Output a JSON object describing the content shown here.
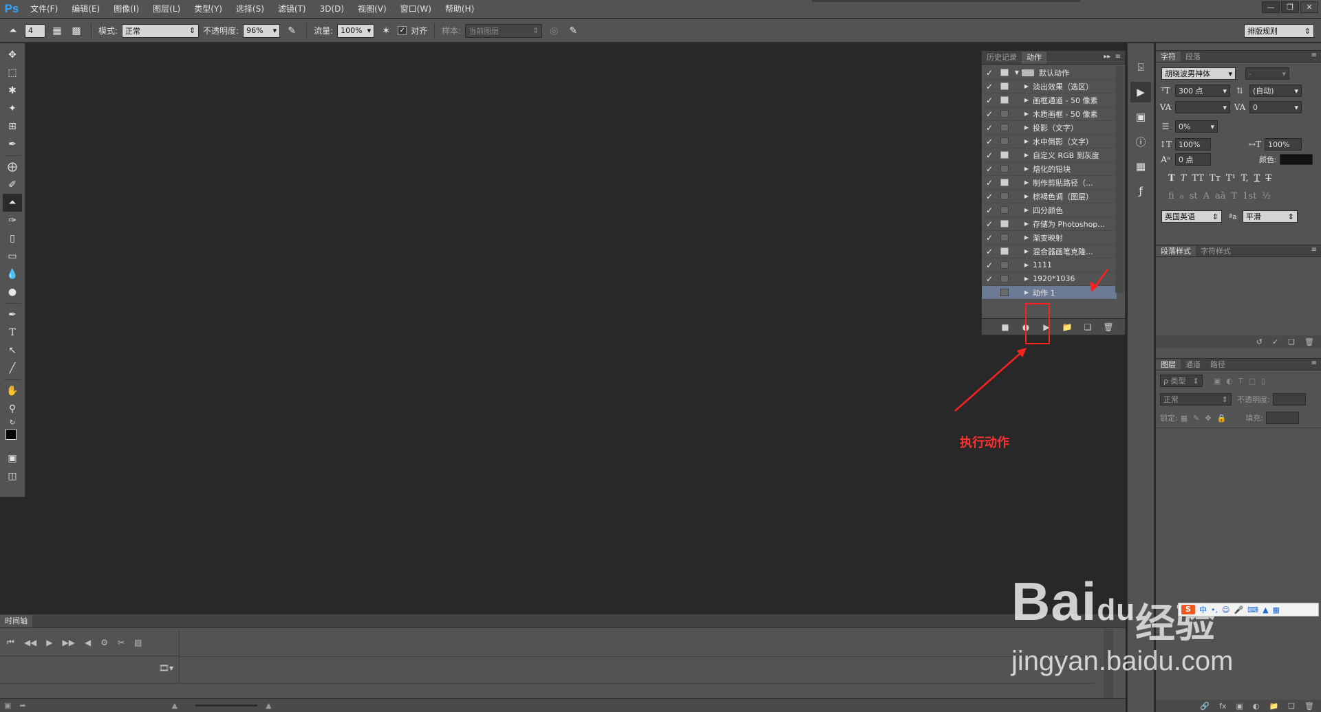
{
  "app": {
    "logo": "Ps",
    "menu": [
      "文件(F)",
      "编辑(E)",
      "图像(I)",
      "图层(L)",
      "类型(Y)",
      "选择(S)",
      "滤镜(T)",
      "3D(D)",
      "视图(V)",
      "窗口(W)",
      "帮助(H)"
    ],
    "window_controls": [
      "minimize-icon",
      "restore-icon",
      "close-icon"
    ]
  },
  "options": {
    "brush_size": "4",
    "mode_label": "模式:",
    "mode_value": "正常",
    "opacity_label": "不透明度:",
    "opacity_value": "96%",
    "flow_label": "流量:",
    "flow_value": "100%",
    "align_label": "对齐",
    "align_checked": true,
    "sample_label": "样本:",
    "sample_value": "当前图层",
    "workspace": "排版规则"
  },
  "tools": [
    "move-tool-icon",
    "marquee-tool-icon",
    "lasso-tool-icon",
    "magic-wand-tool-icon",
    "crop-tool-icon",
    "eyedropper-tool-icon",
    "healing-brush-tool-icon",
    "brush-tool-icon",
    "clone-stamp-tool-icon",
    "history-brush-tool-icon",
    "eraser-tool-icon",
    "gradient-tool-icon",
    "blur-tool-icon",
    "dodge-tool-icon",
    "pen-tool-icon",
    "type-tool-icon",
    "path-selection-tool-icon",
    "line-tool-icon",
    "hand-tool-icon",
    "zoom-tool-icon"
  ],
  "actions_panel": {
    "tabs": [
      "历史记录",
      "动作"
    ],
    "active_tab": "动作",
    "set_name": "默认动作",
    "actions": [
      {
        "name": "淡出效果（选区）",
        "checked": true,
        "dialog": true
      },
      {
        "name": "画框通道 - 50 像素",
        "checked": true,
        "dialog": true
      },
      {
        "name": "木质画框 - 50 像素",
        "checked": true,
        "dialog": false
      },
      {
        "name": "投影（文字）",
        "checked": true,
        "dialog": false
      },
      {
        "name": "水中倒影（文字）",
        "checked": true,
        "dialog": false
      },
      {
        "name": "自定义 RGB 到灰度",
        "checked": true,
        "dialog": true
      },
      {
        "name": "熔化的铅块",
        "checked": true,
        "dialog": false
      },
      {
        "name": "制作剪贴路径（...",
        "checked": true,
        "dialog": true
      },
      {
        "name": "棕褐色调（图层）",
        "checked": true,
        "dialog": false
      },
      {
        "name": "四分颜色",
        "checked": true,
        "dialog": false
      },
      {
        "name": "存储为 Photoshop...",
        "checked": true,
        "dialog": true
      },
      {
        "name": "渐变映射",
        "checked": true,
        "dialog": false
      },
      {
        "name": "混合器画笔克隆...",
        "checked": true,
        "dialog": true
      },
      {
        "name": "1111",
        "checked": true,
        "dialog": false
      },
      {
        "name": "1920*1036",
        "checked": true,
        "dialog": false
      },
      {
        "name": "动作 1",
        "checked": false,
        "dialog": false,
        "selected": true
      }
    ],
    "footer_icons": [
      "stop-icon",
      "record-icon",
      "play-icon",
      "new-set-icon",
      "new-action-icon",
      "delete-icon"
    ]
  },
  "annotation": {
    "label": "执行动作",
    "color": "#ff2020"
  },
  "character_panel": {
    "tabs": [
      "字符",
      "段落"
    ],
    "font_family": "胡晓波男神体",
    "font_style": "-",
    "font_size": "300 点",
    "leading": "(自动)",
    "kerning": "",
    "tracking": "0",
    "scale_pct": "0%",
    "vertical_scale": "100%",
    "horizontal_scale": "100%",
    "baseline_shift": "0 点",
    "color_label": "颜色:",
    "color_value": "#111111",
    "format_buttons": [
      "T",
      "T",
      "TT",
      "Tт",
      "T¹",
      "T,",
      "T",
      "T"
    ],
    "opentype_buttons": [
      "fi",
      "ℴ",
      "st",
      "A",
      "aā",
      "T",
      "1st",
      "½"
    ],
    "language": "英国英语",
    "aa_label": "ªa",
    "antialias": "平滑"
  },
  "paragraph_styles_panel": {
    "tabs": [
      "段落样式",
      "字符样式"
    ]
  },
  "layers_panel": {
    "tabs": [
      "图层",
      "通道",
      "路径"
    ],
    "filter_label": "ρ 类型",
    "blend_mode": "正常",
    "opacity_label": "不透明度:",
    "lock_label": "锁定:",
    "fill_label": "填充:"
  },
  "timeline": {
    "tab": "时间轴"
  },
  "watermark": {
    "brand": "Bai",
    "brand_suffix": "du",
    "jingyan": "经验",
    "url": "jingyan.baidu.com"
  },
  "ime": {
    "logo": "S",
    "mode": "中"
  }
}
